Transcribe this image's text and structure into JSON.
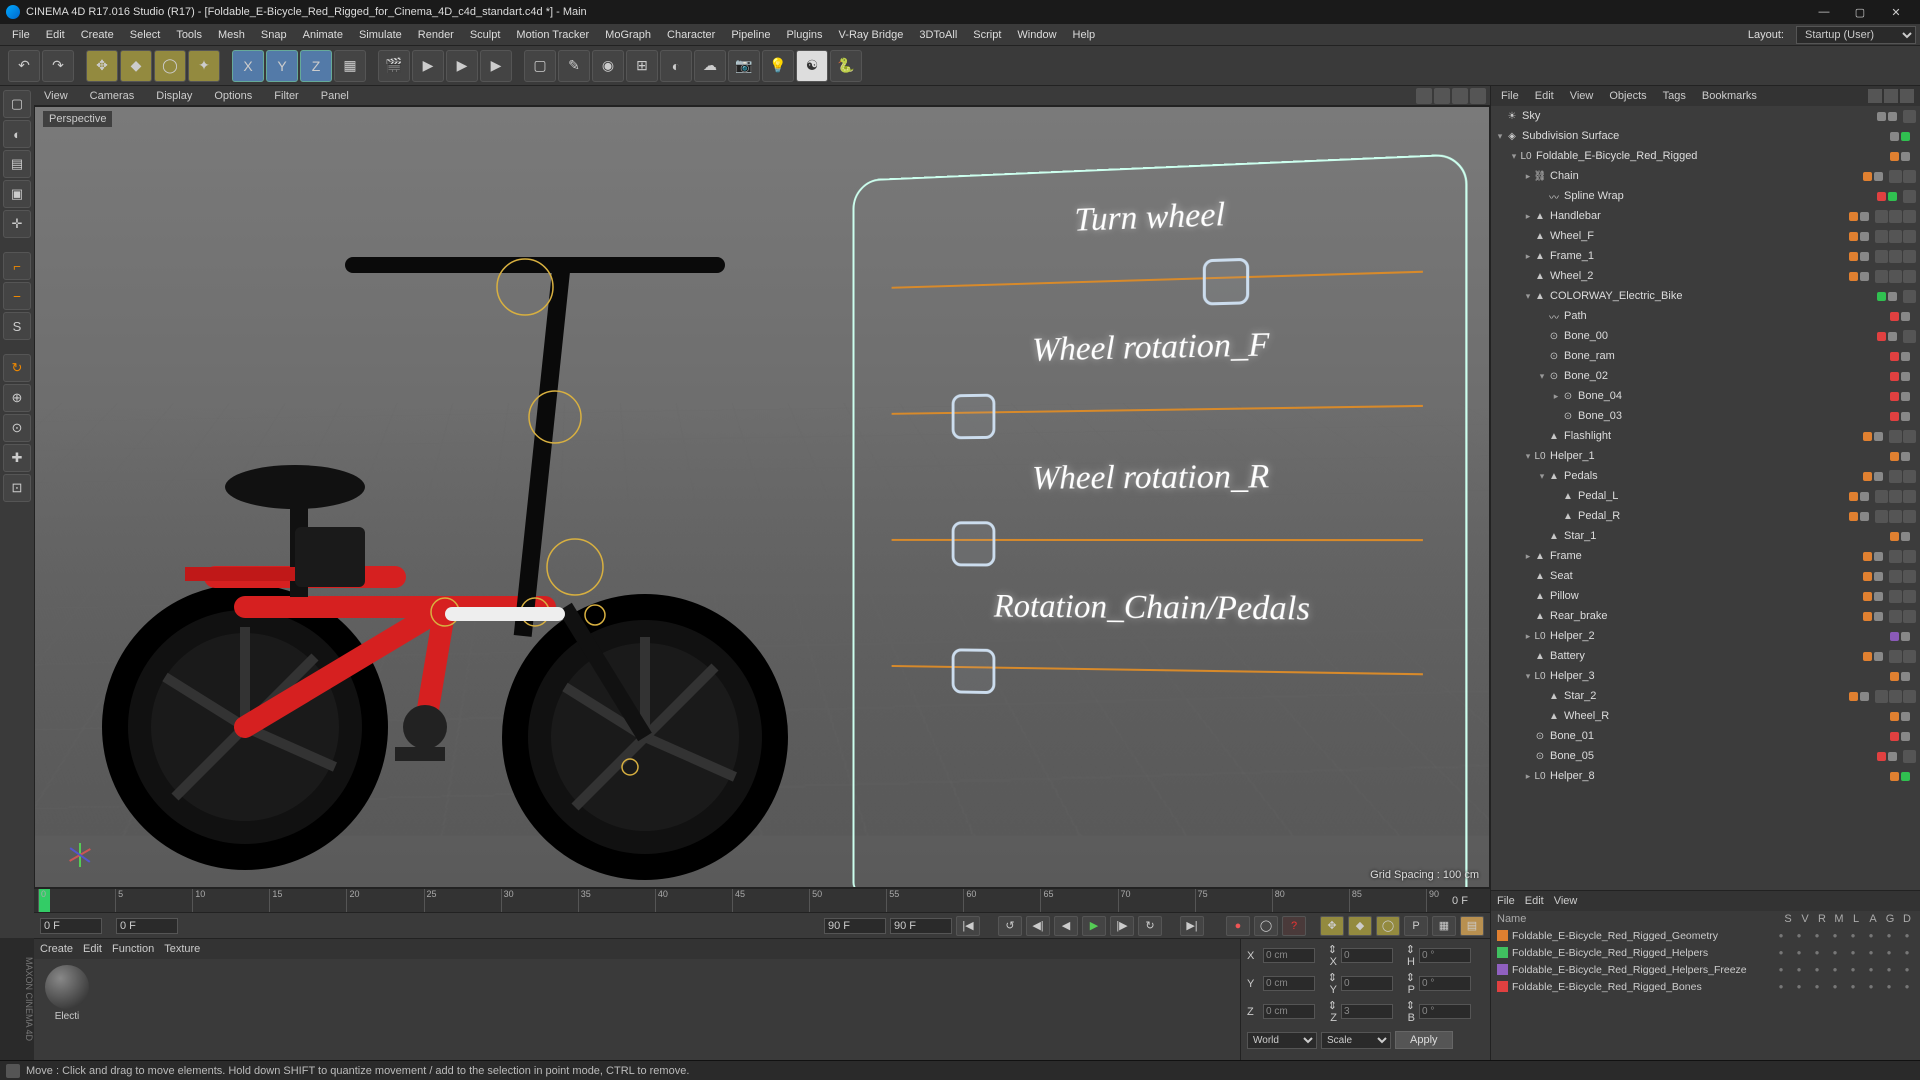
{
  "title": "CINEMA 4D R17.016 Studio (R17) - [Foldable_E-Bicycle_Red_Rigged_for_Cinema_4D_c4d_standart.c4d *] - Main",
  "menu": [
    "File",
    "Edit",
    "Create",
    "Select",
    "Tools",
    "Mesh",
    "Snap",
    "Animate",
    "Simulate",
    "Render",
    "Sculpt",
    "Motion Tracker",
    "MoGraph",
    "Character",
    "Pipeline",
    "Plugins",
    "V-Ray Bridge",
    "3DToAll",
    "Script",
    "Window",
    "Help"
  ],
  "layout_label": "Layout:",
  "layout_value": "Startup (User)",
  "viewport_menu": [
    "View",
    "Cameras",
    "Display",
    "Options",
    "Filter",
    "Panel"
  ],
  "viewport_label": "Perspective",
  "grid_spacing": "Grid Spacing : 100 cm",
  "hud": [
    {
      "label": "Turn wheel",
      "thumb_pct": 60
    },
    {
      "label": "Wheel rotation_F",
      "thumb_pct": 12
    },
    {
      "label": "Wheel rotation_R",
      "thumb_pct": 12
    },
    {
      "label": "Rotation_Chain/Pedals",
      "thumb_pct": 12
    }
  ],
  "timeline": {
    "start": 0,
    "end": 90,
    "current": "0 F",
    "start_field": "0 F",
    "end_field": "90 F",
    "range_end": "90 F"
  },
  "coords": {
    "X": "0 cm",
    "Y": "0 cm",
    "Z": "0 cm",
    "sX": "0",
    "sY": "0",
    "sZ": "3",
    "H": "0 °",
    "P": "0 °",
    "B": "0 °",
    "space": "World",
    "scale": "Scale",
    "apply": "Apply"
  },
  "mat_menu": [
    "Create",
    "Edit",
    "Function",
    "Texture"
  ],
  "materials": [
    {
      "name": "Electi"
    }
  ],
  "obj_menu": [
    "File",
    "Edit",
    "View",
    "Objects",
    "Tags",
    "Bookmarks"
  ],
  "objects": [
    {
      "d": 0,
      "exp": "",
      "ico": "☀",
      "name": "Sky",
      "dots": [
        "grey",
        "grey"
      ],
      "tags": 1
    },
    {
      "d": 0,
      "exp": "▾",
      "ico": "◈",
      "name": "Subdivision Surface",
      "dots": [
        "grey",
        "green"
      ],
      "tags": 0
    },
    {
      "d": 1,
      "exp": "▾",
      "ico": "L0",
      "name": "Foldable_E-Bicycle_Red_Rigged",
      "dots": [
        "orange",
        "grey"
      ],
      "tags": 0
    },
    {
      "d": 2,
      "exp": "▸",
      "ico": "⛓",
      "name": "Chain",
      "dots": [
        "orange",
        "grey"
      ],
      "tags": 2
    },
    {
      "d": 3,
      "exp": "",
      "ico": "〰",
      "name": "Spline Wrap",
      "dots": [
        "red",
        "green"
      ],
      "tags": 1
    },
    {
      "d": 2,
      "exp": "▸",
      "ico": "▲",
      "name": "Handlebar",
      "dots": [
        "orange",
        "grey"
      ],
      "tags": 3
    },
    {
      "d": 2,
      "exp": "",
      "ico": "▲",
      "name": "Wheel_F",
      "dots": [
        "orange",
        "grey"
      ],
      "tags": 3
    },
    {
      "d": 2,
      "exp": "▸",
      "ico": "▲",
      "name": "Frame_1",
      "dots": [
        "orange",
        "grey"
      ],
      "tags": 3
    },
    {
      "d": 2,
      "exp": "",
      "ico": "▲",
      "name": "Wheel_2",
      "dots": [
        "orange",
        "grey"
      ],
      "tags": 3
    },
    {
      "d": 2,
      "exp": "▾",
      "ico": "▲",
      "name": "COLORWAY_Electric_Bike",
      "dots": [
        "green",
        "grey"
      ],
      "tags": 1
    },
    {
      "d": 3,
      "exp": "",
      "ico": "〰",
      "name": "Path",
      "dots": [
        "red",
        "grey"
      ],
      "tags": 0
    },
    {
      "d": 3,
      "exp": "",
      "ico": "⊙",
      "name": "Bone_00",
      "dots": [
        "red",
        "grey"
      ],
      "tags": 1
    },
    {
      "d": 3,
      "exp": "",
      "ico": "⊙",
      "name": "Bone_ram",
      "dots": [
        "red",
        "grey"
      ],
      "tags": 0
    },
    {
      "d": 3,
      "exp": "▾",
      "ico": "⊙",
      "name": "Bone_02",
      "dots": [
        "red",
        "grey"
      ],
      "tags": 0
    },
    {
      "d": 4,
      "exp": "▸",
      "ico": "⊙",
      "name": "Bone_04",
      "dots": [
        "red",
        "grey"
      ],
      "tags": 0
    },
    {
      "d": 4,
      "exp": "",
      "ico": "⊙",
      "name": "Bone_03",
      "dots": [
        "red",
        "grey"
      ],
      "tags": 0
    },
    {
      "d": 3,
      "exp": "",
      "ico": "▲",
      "name": "Flashlight",
      "dots": [
        "orange",
        "grey"
      ],
      "tags": 2
    },
    {
      "d": 2,
      "exp": "▾",
      "ico": "L0",
      "name": "Helper_1",
      "dots": [
        "orange",
        "grey"
      ],
      "tags": 0
    },
    {
      "d": 3,
      "exp": "▾",
      "ico": "▲",
      "name": "Pedals",
      "dots": [
        "orange",
        "grey"
      ],
      "tags": 2
    },
    {
      "d": 4,
      "exp": "",
      "ico": "▲",
      "name": "Pedal_L",
      "dots": [
        "orange",
        "grey"
      ],
      "tags": 3
    },
    {
      "d": 4,
      "exp": "",
      "ico": "▲",
      "name": "Pedal_R",
      "dots": [
        "orange",
        "grey"
      ],
      "tags": 3
    },
    {
      "d": 3,
      "exp": "",
      "ico": "▲",
      "name": "Star_1",
      "dots": [
        "orange",
        "grey"
      ],
      "tags": 0
    },
    {
      "d": 2,
      "exp": "▸",
      "ico": "▲",
      "name": "Frame",
      "dots": [
        "orange",
        "grey"
      ],
      "tags": 2
    },
    {
      "d": 2,
      "exp": "",
      "ico": "▲",
      "name": "Seat",
      "dots": [
        "orange",
        "grey"
      ],
      "tags": 2
    },
    {
      "d": 2,
      "exp": "",
      "ico": "▲",
      "name": "Pillow",
      "dots": [
        "orange",
        "grey"
      ],
      "tags": 2
    },
    {
      "d": 2,
      "exp": "",
      "ico": "▲",
      "name": "Rear_brake",
      "dots": [
        "orange",
        "grey"
      ],
      "tags": 2
    },
    {
      "d": 2,
      "exp": "▸",
      "ico": "L0",
      "name": "Helper_2",
      "dots": [
        "purple",
        "grey"
      ],
      "tags": 0
    },
    {
      "d": 2,
      "exp": "",
      "ico": "▲",
      "name": "Battery",
      "dots": [
        "orange",
        "grey"
      ],
      "tags": 2
    },
    {
      "d": 2,
      "exp": "▾",
      "ico": "L0",
      "name": "Helper_3",
      "dots": [
        "orange",
        "grey"
      ],
      "tags": 0
    },
    {
      "d": 3,
      "exp": "",
      "ico": "▲",
      "name": "Star_2",
      "dots": [
        "orange",
        "grey"
      ],
      "tags": 3
    },
    {
      "d": 3,
      "exp": "",
      "ico": "▲",
      "name": "Wheel_R",
      "dots": [
        "orange",
        "grey"
      ],
      "tags": 0
    },
    {
      "d": 2,
      "exp": "",
      "ico": "⊙",
      "name": "Bone_01",
      "dots": [
        "red",
        "grey"
      ],
      "tags": 0
    },
    {
      "d": 2,
      "exp": "",
      "ico": "⊙",
      "name": "Bone_05",
      "dots": [
        "red",
        "grey"
      ],
      "tags": 1
    },
    {
      "d": 2,
      "exp": "▸",
      "ico": "L0",
      "name": "Helper_8",
      "dots": [
        "orange",
        "green"
      ],
      "tags": 0
    }
  ],
  "layer_menu": [
    "File",
    "Edit",
    "View"
  ],
  "layer_cols": [
    "S",
    "V",
    "R",
    "M",
    "L",
    "A",
    "G",
    "D"
  ],
  "layer_name_hdr": "Name",
  "layers": [
    {
      "color": "#e08030",
      "name": "Foldable_E-Bicycle_Red_Rigged_Geometry"
    },
    {
      "color": "#40c060",
      "name": "Foldable_E-Bicycle_Red_Rigged_Helpers"
    },
    {
      "color": "#9060c0",
      "name": "Foldable_E-Bicycle_Red_Rigged_Helpers_Freeze"
    },
    {
      "color": "#e04040",
      "name": "Foldable_E-Bicycle_Red_Rigged_Bones"
    }
  ],
  "status": "Move : Click and drag to move elements. Hold down SHIFT to quantize movement / add to the selection in point mode, CTRL to remove."
}
